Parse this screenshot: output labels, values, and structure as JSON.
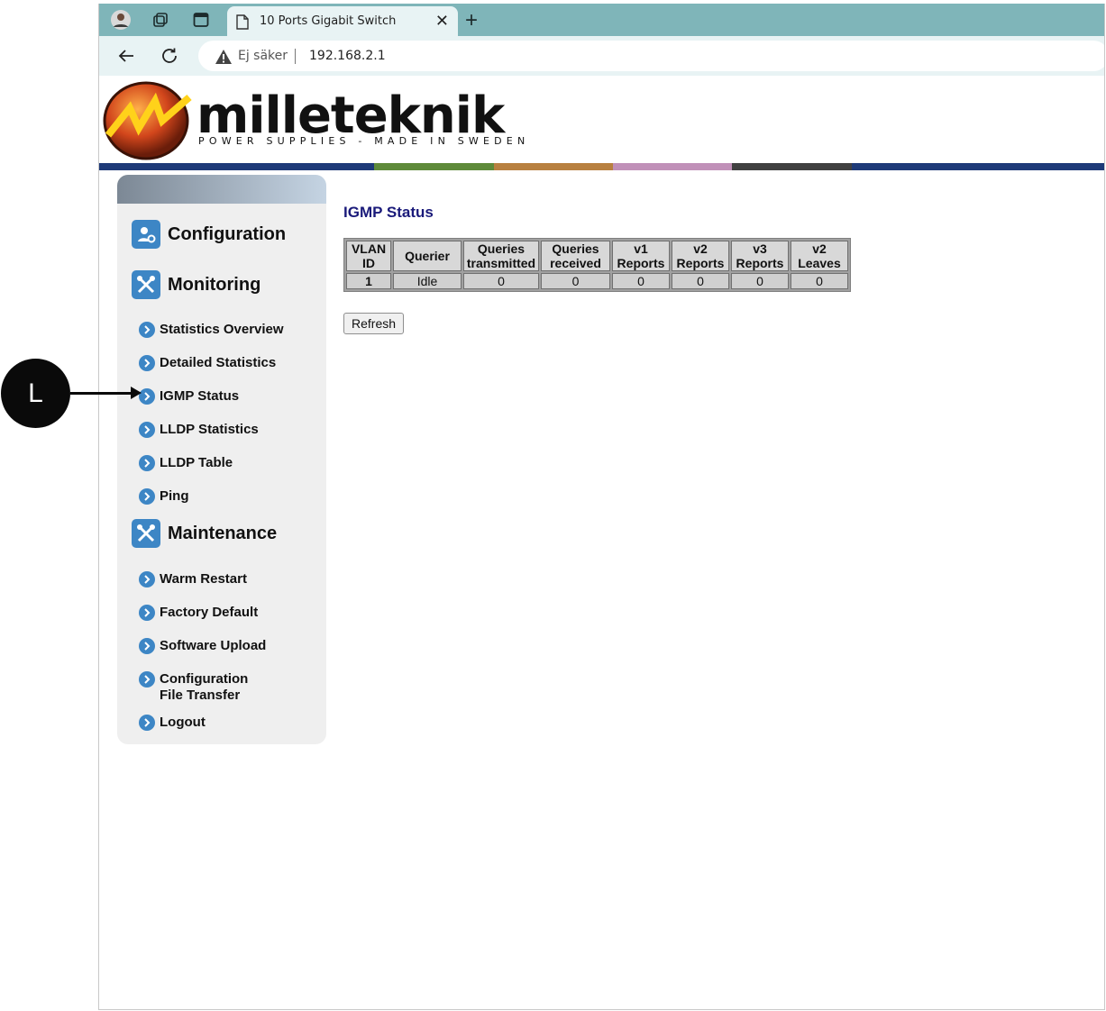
{
  "browser": {
    "tab_title": "10 Ports Gigabit Switch",
    "security_label": "Ej säker",
    "url": "192.168.2.1"
  },
  "header": {
    "brand": "milleteknik",
    "tagline": "POWER SUPPLIES - MADE IN SWEDEN",
    "stripe_colors": [
      "#1e3a78",
      "#5e8a3a",
      "#b88040",
      "#c090b8",
      "#404040",
      "#1e3a78"
    ]
  },
  "sidebar": {
    "sections": [
      {
        "label": "Configuration",
        "icon": "configuration-icon"
      },
      {
        "label": "Monitoring",
        "icon": "tools-icon"
      },
      {
        "label": "Maintenance",
        "icon": "tools-icon"
      }
    ],
    "monitoring_items": [
      "Statistics Overview",
      "Detailed Statistics",
      "IGMP Status",
      "LLDP Statistics",
      "LLDP Table",
      "Ping"
    ],
    "maintenance_items": [
      "Warm Restart",
      "Factory Default",
      "Software Upload",
      "Configuration File Transfer",
      "Logout"
    ]
  },
  "main": {
    "title": "IGMP Status",
    "table": {
      "headers": [
        [
          "VLAN",
          "ID"
        ],
        [
          "Querier"
        ],
        [
          "Queries",
          "transmitted"
        ],
        [
          "Queries",
          "received"
        ],
        [
          "v1",
          "Reports"
        ],
        [
          "v2",
          "Reports"
        ],
        [
          "v3",
          "Reports"
        ],
        [
          "v2",
          "Leaves"
        ]
      ],
      "rows": [
        [
          "1",
          "Idle",
          "0",
          "0",
          "0",
          "0",
          "0",
          "0"
        ]
      ]
    },
    "refresh_label": "Refresh"
  },
  "annotation": {
    "label": "L"
  }
}
